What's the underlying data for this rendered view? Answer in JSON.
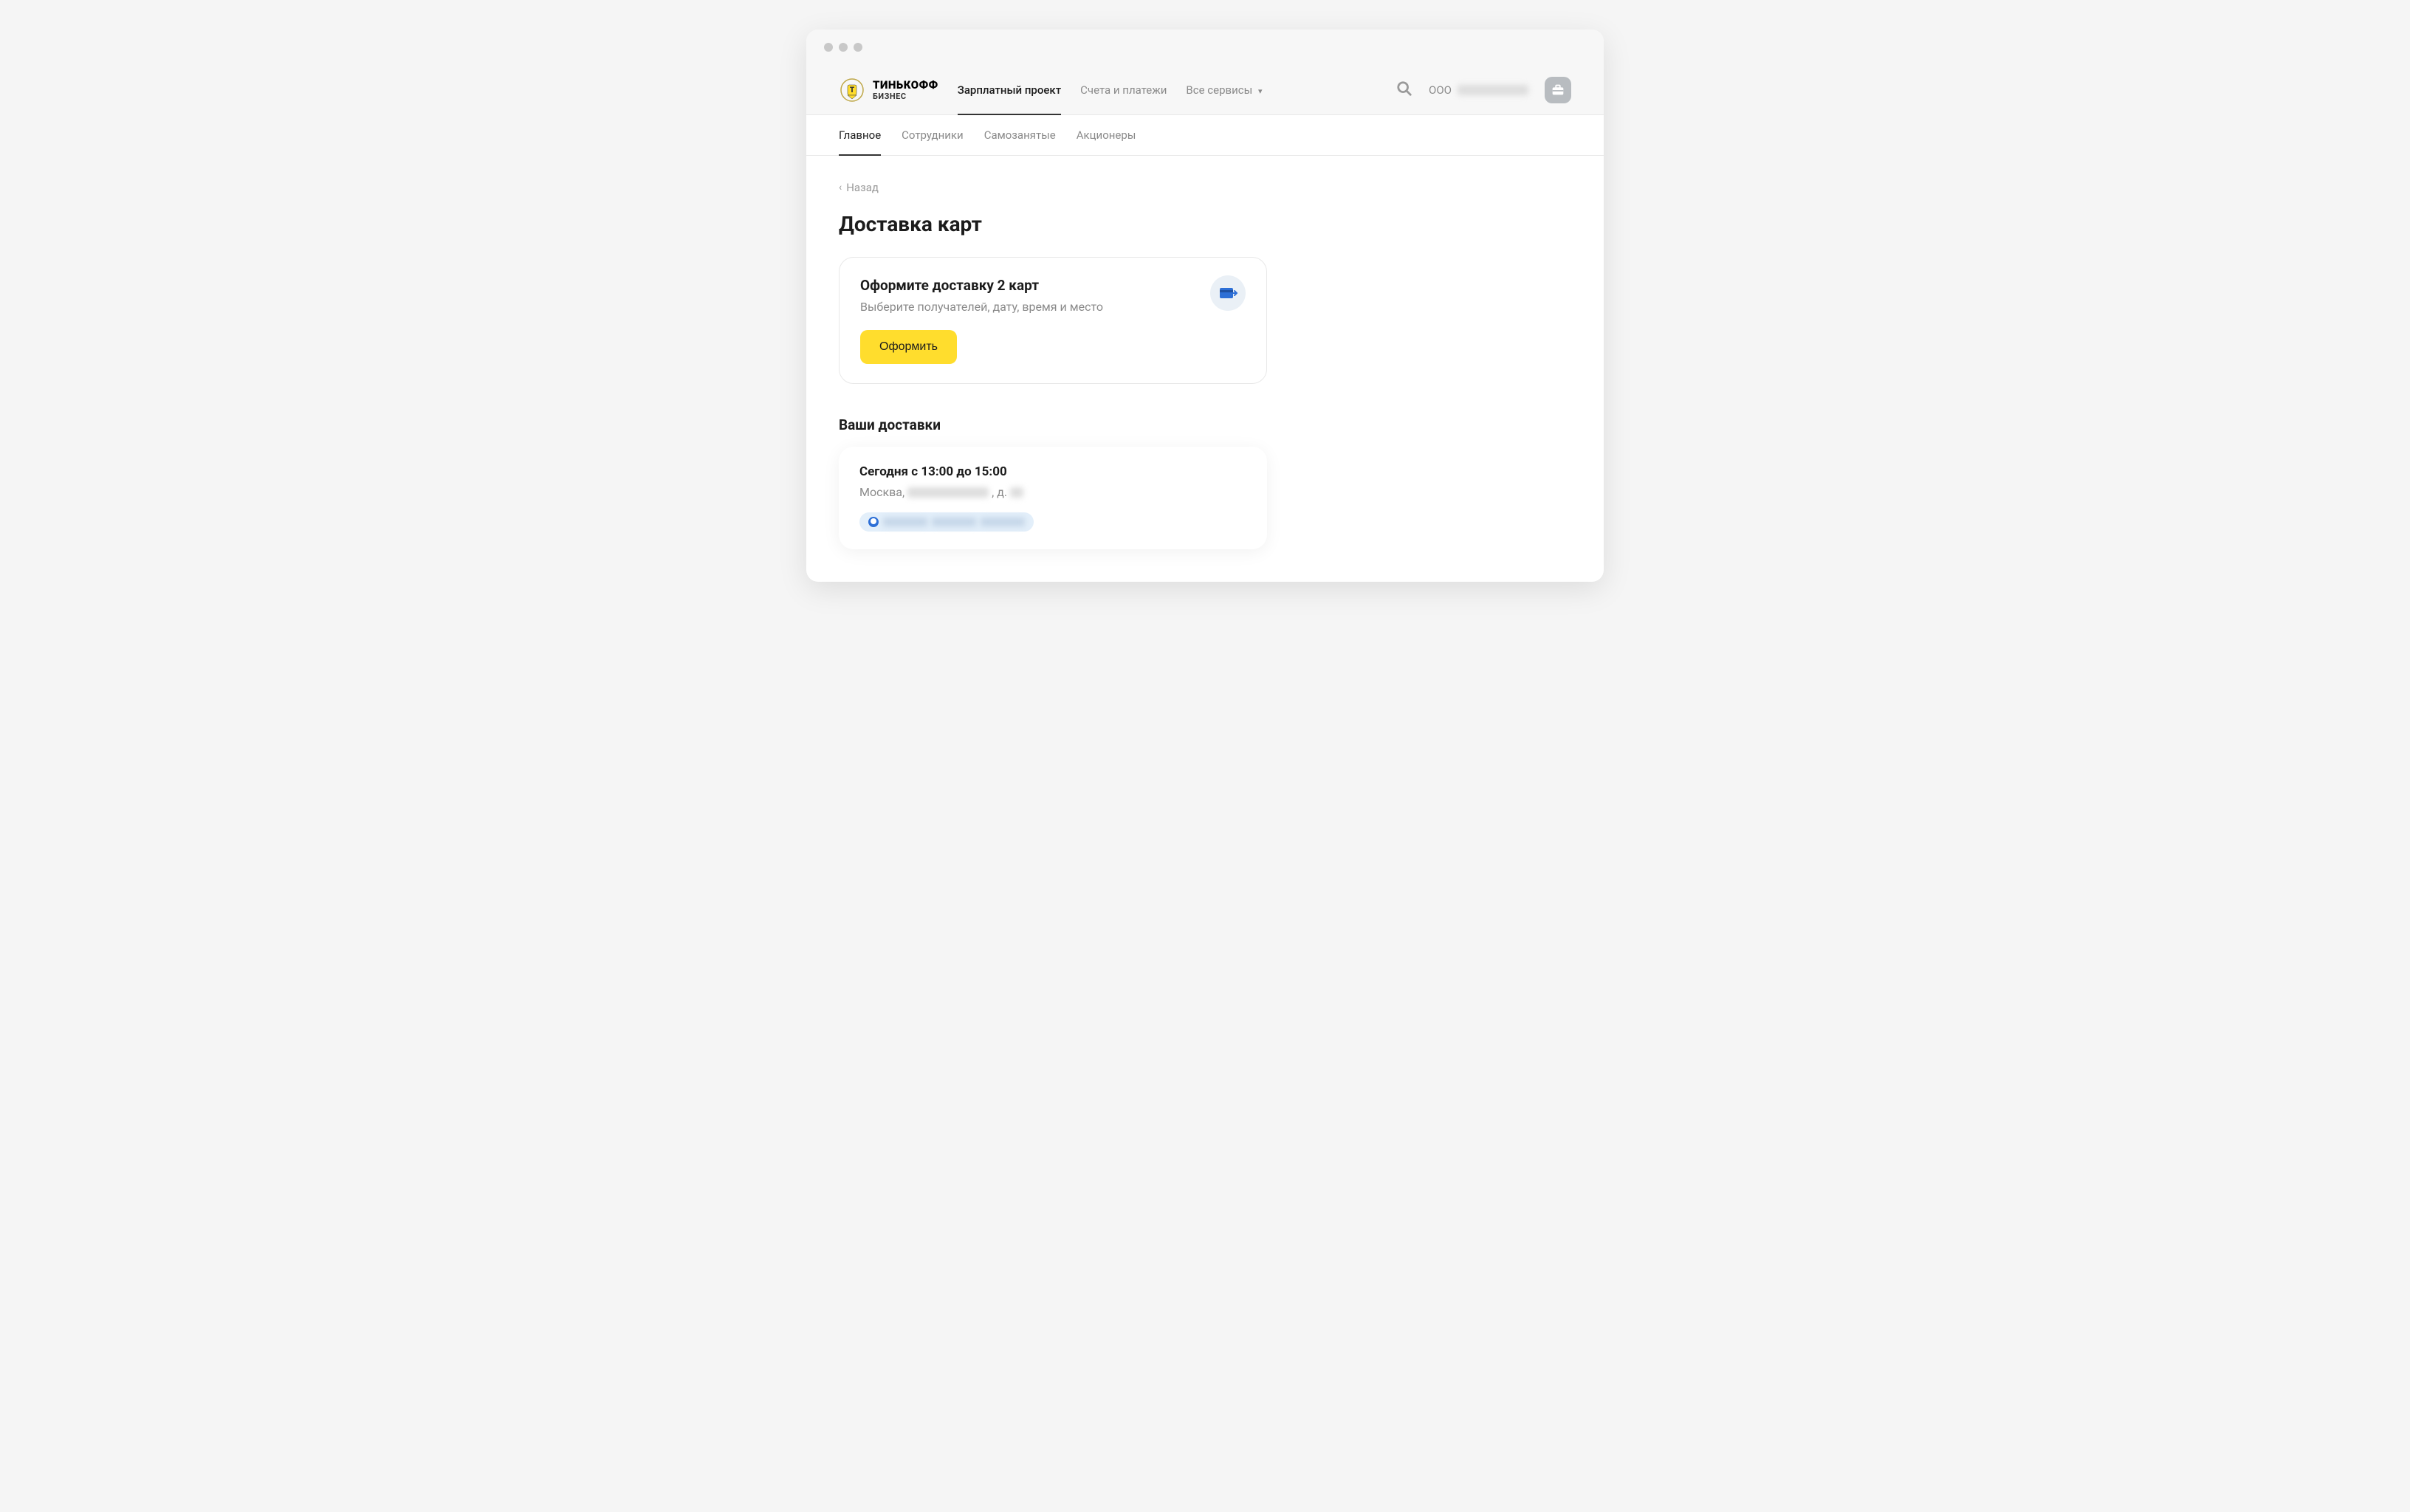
{
  "header": {
    "logo": {
      "line1": "ТИНЬКОФФ",
      "line2": "БИЗНЕС"
    },
    "nav": [
      {
        "label": "Зарплатный проект",
        "active": true
      },
      {
        "label": "Счета и платежи",
        "active": false
      },
      {
        "label": "Все сервисы",
        "active": false,
        "dropdown": true
      }
    ],
    "company_prefix": "ООО"
  },
  "subnav": [
    {
      "label": "Главное",
      "active": true
    },
    {
      "label": "Сотрудники",
      "active": false
    },
    {
      "label": "Самозанятые",
      "active": false
    },
    {
      "label": "Акционеры",
      "active": false
    }
  ],
  "back": {
    "label": "Назад"
  },
  "page": {
    "title": "Доставка карт"
  },
  "promo": {
    "title": "Оформите доставку 2 карт",
    "subtitle": "Выберите получателей, дату, время и место",
    "button": "Оформить"
  },
  "deliveries": {
    "section_title": "Ваши доставки",
    "items": [
      {
        "time_label": "Сегодня с 13:00 до 15:00",
        "address_prefix": "Москва,",
        "address_mid": ", д."
      }
    ]
  }
}
